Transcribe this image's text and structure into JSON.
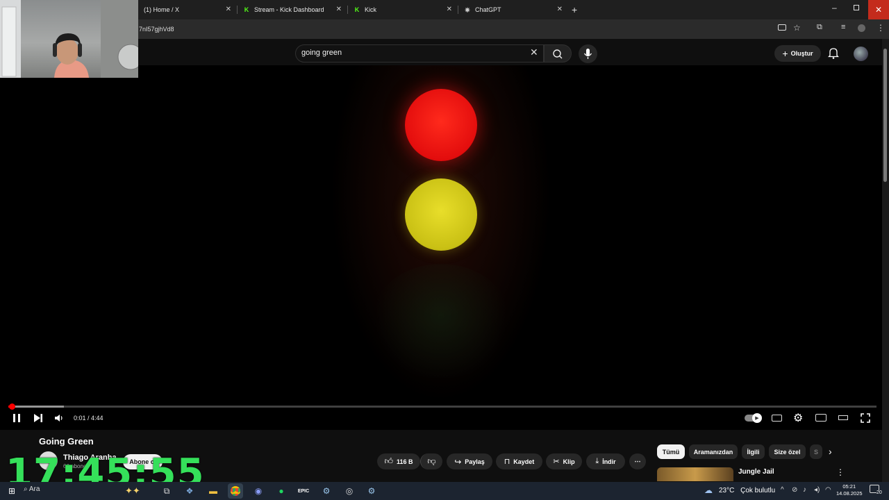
{
  "browser": {
    "tabs": [
      {
        "label": "(1) Home / X",
        "icon": "x-logo-icon"
      },
      {
        "label": "Stream - Kick Dashboard",
        "icon": "kick-logo-icon"
      },
      {
        "label": "Kick",
        "icon": "kick-logo-icon"
      },
      {
        "label": "ChatGPT",
        "icon": "chatgpt-logo-icon"
      }
    ],
    "new_tab_symbol": "+",
    "url_fragment": "7nI57gjhVd8",
    "window_controls": [
      "minimize-icon",
      "restore-icon",
      "close-icon"
    ],
    "close_button_color": "#c42b1c"
  },
  "youtube": {
    "search": {
      "value": "going green",
      "clear_symbol": "✕"
    },
    "create_label": "Oluştur",
    "player": {
      "current_time": "0:01",
      "duration": "4:44",
      "time_display": "0:01 / 4:44",
      "progress_fraction": 0.004,
      "buffered_fraction": 0.064,
      "progress_color": "#ff0000",
      "lights": {
        "red": "#ff1a10",
        "yellow": "#d4cb1c",
        "green": "#102810"
      }
    },
    "video": {
      "title": "Going Green",
      "channel": "Thiago Aranha",
      "subscribers_partial": "66 abone",
      "subscribe_label": "Abone ol"
    },
    "actions": {
      "like_count": "116 B",
      "share": "Paylaş",
      "save": "Kaydet",
      "clip": "Klip",
      "download": "İndir"
    },
    "chips": [
      "Tümü",
      "Aramanızdan",
      "İlgili",
      "Size özel",
      "S"
    ],
    "sidebar": {
      "first_title": "Jungle Jail"
    }
  },
  "overlay": {
    "clock": "17:45:55",
    "clock_color": "#35e05a"
  },
  "taskbar": {
    "search_label": "Ara",
    "weather_temp": "23°C",
    "weather_desc": "Çok bulutlu",
    "time": "05:21",
    "date": "14.08.2025",
    "notification_count": "20"
  }
}
